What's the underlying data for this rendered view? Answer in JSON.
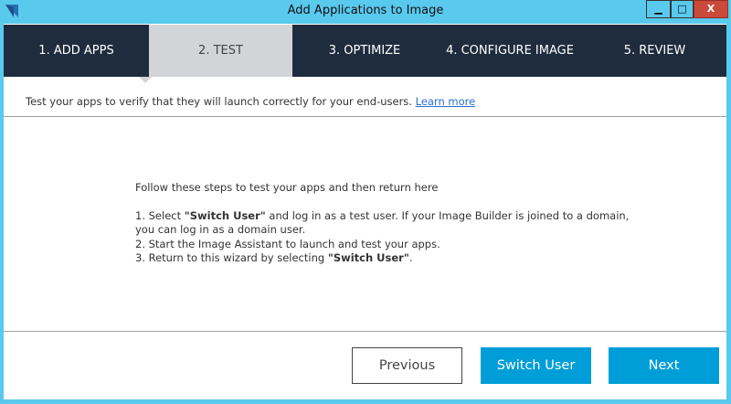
{
  "window": {
    "title": "Add Applications to Image",
    "minimize": "▁",
    "maximize": "□",
    "close": "X"
  },
  "tabs": [
    {
      "label": "1. ADD APPS"
    },
    {
      "label": "2. TEST",
      "active": true
    },
    {
      "label": "3. OPTIMIZE"
    },
    {
      "label": "4. CONFIGURE IMAGE"
    },
    {
      "label": "5. REVIEW"
    }
  ],
  "description": {
    "text": "Test your apps to verify that they will launch correctly for your end-users. ",
    "link": "Learn more"
  },
  "instructions": {
    "intro": "Follow these steps to test your apps and then return here",
    "step1_pre": "1. Select ",
    "step1_bold": "\"Switch User\"",
    "step1_post": " and log in as a test user. If your Image Builder is joined to a domain,",
    "step1_line2": "you can log in as a domain user.",
    "step2": "2. Start the Image Assistant to launch and test your apps.",
    "step3_pre": "3. Return to this wizard by selecting ",
    "step3_bold": "\"Switch User\"",
    "step3_post": "."
  },
  "buttons": {
    "previous": "Previous",
    "switch_user": "Switch User",
    "next": "Next"
  }
}
